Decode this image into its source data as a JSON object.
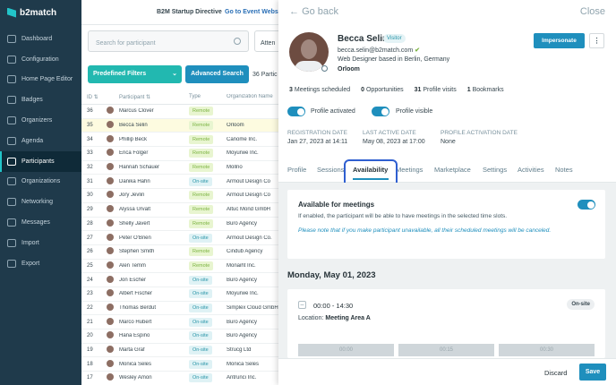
{
  "app": {
    "name": "b2match",
    "title": "B2M Startup Directive",
    "event_link": "Go to Event Websi"
  },
  "sidebar": {
    "items": [
      {
        "label": "Dashboard",
        "icon": "dashboard-icon"
      },
      {
        "label": "Configuration",
        "icon": "wrench-icon"
      },
      {
        "label": "Home Page Editor",
        "icon": "monitor-icon"
      },
      {
        "label": "Badges",
        "icon": "badge-icon"
      },
      {
        "label": "Organizers",
        "icon": "user-icon"
      },
      {
        "label": "Agenda",
        "icon": "calendar-icon"
      },
      {
        "label": "Participants",
        "icon": "users-icon",
        "active": true
      },
      {
        "label": "Organizations",
        "icon": "building-icon"
      },
      {
        "label": "Networking",
        "icon": "network-icon"
      },
      {
        "label": "Messages",
        "icon": "mail-icon"
      },
      {
        "label": "Import",
        "icon": "import-icon"
      },
      {
        "label": "Export",
        "icon": "export-icon"
      }
    ]
  },
  "filters": {
    "search_placeholder": "Search for participant",
    "attend_label": "Atten",
    "predefined": "Predefined Filters",
    "advanced": "Advanced Search",
    "count": "36 Partic"
  },
  "table": {
    "headers": {
      "id": "ID",
      "participant": "Participant",
      "type": "Type",
      "org": "Organization Name"
    },
    "rows": [
      {
        "id": "36",
        "name": "Marcus Clover",
        "type": "Remote",
        "org": ""
      },
      {
        "id": "35",
        "name": "Becca Selin",
        "type": "Remote",
        "org": "Orloom",
        "hl": true
      },
      {
        "id": "34",
        "name": "Phillip Beck",
        "type": "Remote",
        "org": "Canome Inc."
      },
      {
        "id": "33",
        "name": "Erica Folger",
        "type": "Remote",
        "org": "Moyurwe Inc."
      },
      {
        "id": "32",
        "name": "Hannah Schauer",
        "type": "Remote",
        "org": "Mollno"
      },
      {
        "id": "31",
        "name": "Danika Hahn",
        "type": "On-site",
        "org": "Armout Design Co"
      },
      {
        "id": "30",
        "name": "Jory Jevlin",
        "type": "Remote",
        "org": "Armout Design Co"
      },
      {
        "id": "29",
        "name": "Alyssa Urvalt",
        "type": "Remote",
        "org": "Altuc Mond GmbH"
      },
      {
        "id": "28",
        "name": "Shelly Javert",
        "type": "Remote",
        "org": "Buro Agency"
      },
      {
        "id": "27",
        "name": "Peter O'Brien",
        "type": "On-site",
        "org": "Armout Design Co."
      },
      {
        "id": "26",
        "name": "Stephen Smith",
        "type": "Remote",
        "org": "Cindub Agency"
      },
      {
        "id": "25",
        "name": "Alen Temm",
        "type": "Remote",
        "org": "Monaiht Inc."
      },
      {
        "id": "24",
        "name": "Jon Escher",
        "type": "On-site",
        "org": "Buro Agency"
      },
      {
        "id": "23",
        "name": "Albert Fischer",
        "type": "On-site",
        "org": "Moyurwe Inc."
      },
      {
        "id": "22",
        "name": "Thomas Berdut",
        "type": "On-site",
        "org": "Simplex Cloud GmbH"
      },
      {
        "id": "21",
        "name": "Marco Hubert",
        "type": "On-site",
        "org": "Buro Agency"
      },
      {
        "id": "20",
        "name": "Hana Espino",
        "type": "On-site",
        "org": "Buro Agency"
      },
      {
        "id": "19",
        "name": "Marta Graf",
        "type": "On-site",
        "org": "Strucg Ltd"
      },
      {
        "id": "18",
        "name": "Monica Seles",
        "type": "On-site",
        "org": "Monica Seles"
      },
      {
        "id": "17",
        "name": "Wesley Amon",
        "type": "On-site",
        "org": "Antrunci Inc."
      }
    ]
  },
  "panel": {
    "back": "Go back",
    "close": "Close",
    "name": "Becca Selin",
    "badge": "Visitor",
    "email": "becca.selin@b2match.com",
    "title": "Web Designer based in Berlin, Germany",
    "org": "Orloom",
    "impersonate": "Impersonate",
    "more": "⋮",
    "stats": [
      {
        "num": "3",
        "label": "Meetings scheduled"
      },
      {
        "num": "0",
        "label": "Opportunities"
      },
      {
        "num": "31",
        "label": "Profile visits"
      },
      {
        "num": "1",
        "label": "Bookmarks"
      }
    ],
    "profile_activated": "Profile activated",
    "profile_visible": "Profile visible",
    "reg_label": "REGISTRATION DATE",
    "reg_value": "Jan 27, 2023 at 14:11",
    "last_label": "LAST ACTIVE DATE",
    "last_value": "May 08, 2023 at 17:00",
    "act_label": "PROFILE ACTIVATION DATE",
    "act_value": "None",
    "tabs": [
      "Profile",
      "Sessions",
      "Availability",
      "Meetings",
      "Marketplace",
      "Settings",
      "Activities",
      "Notes"
    ],
    "avail_title": "Available for meetings",
    "avail_desc": "If enabled, the participant will be able to have meetings in the selected time slots.",
    "avail_note": "Please note that if you make participant unavailable, all their scheduled meetings will be canceled.",
    "date": "Monday, May 01, 2023",
    "slot_time": "00:00 - 14:30",
    "slot_badge": "On-site",
    "slot_loc_label": "Location:",
    "slot_loc": "Meeting Area A",
    "subslots": [
      "00:00",
      "00:15",
      "00:30"
    ],
    "discard": "Discard",
    "save": "Save"
  }
}
